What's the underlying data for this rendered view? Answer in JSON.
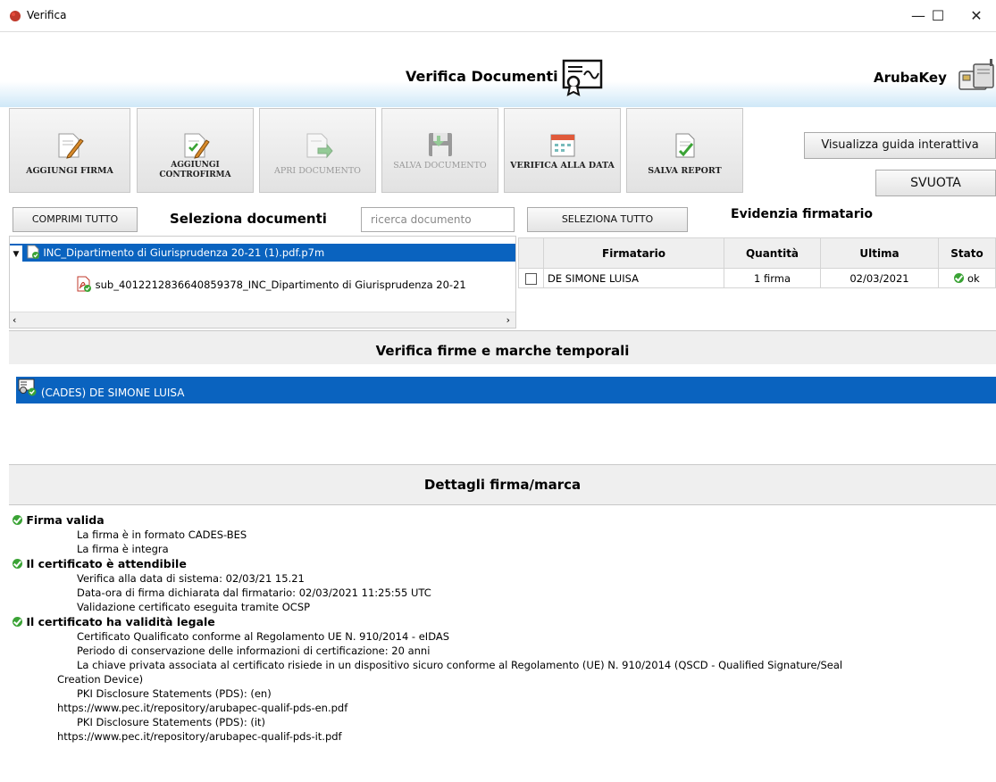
{
  "window": {
    "title": "Verifica",
    "minimize": "—",
    "maximize": "☐",
    "close": "✕"
  },
  "header": {
    "title": "Verifica Documenti",
    "brand": "ArubaKey"
  },
  "toolbar": {
    "add_signature": "AGGIUNGI FIRMA",
    "add_countersignature": "AGGIUNGI CONTROFIRMA",
    "open_document": "APRI DOCUMENTO",
    "save_document": "SALVA DOCUMENTO",
    "verify_at_date": "VERIFICA ALLA DATA",
    "save_report": "SALVA REPORT",
    "guide": "Visualizza guida interattiva",
    "empty": "SVUOTA"
  },
  "documents": {
    "collapse_all": "COMPRIMI TUTTO",
    "section_label": "Seleziona documenti",
    "search_placeholder": "ricerca documento",
    "tree": [
      "INC_Dipartimento di Giurisprudenza 20-21 (1).pdf.p7m",
      "sub_4012212836640859378_INC_Dipartimento di Giurisprudenza 20-21"
    ]
  },
  "signers": {
    "select_all": "SELEZIONA TUTTO",
    "section_label": "Evidenzia firmatario",
    "columns": [
      "Firmatario",
      "Quantità",
      "Ultima",
      "Stato"
    ],
    "rows": [
      {
        "name": "DE SIMONE LUISA",
        "qty": "1 firma",
        "last": "02/03/2021",
        "status": "ok"
      }
    ]
  },
  "verification": {
    "section_label": "Verifica firme e marche temporali",
    "items": [
      "(CADES) DE SIMONE LUISA"
    ]
  },
  "details": {
    "section_label": "Dettagli firma/marca",
    "lines": [
      "Firma valida",
      "La firma è in formato CADES-BES",
      "La firma è integra",
      "Il certificato è attendibile",
      "Verifica alla data di sistema: 02/03/21 15.21",
      "Data-ora di firma dichiarata dal firmatario: 02/03/2021 11:25:55 UTC",
      "Validazione certificato eseguita tramite OCSP",
      "Il certificato ha validità legale",
      "Certificato Qualificato conforme al Regolamento UE N. 910/2014 - eIDAS",
      "Periodo di conservazione delle informazioni di certificazione: 20 anni",
      "La chiave privata associata al certificato risiede in un dispositivo sicuro conforme al Regolamento (UE) N. 910/2014 (QSCD - Qualified Signature/Seal",
      "Creation Device)",
      "PKI Disclosure Statements (PDS): (en)",
      "https://www.pec.it/repository/arubapec-qualif-pds-en.pdf",
      "PKI Disclosure Statements (PDS): (it)",
      "https://www.pec.it/repository/arubapec-qualif-pds-it.pdf"
    ]
  },
  "colors": {
    "selection": "#0a63bf",
    "ok_green": "#3aa335"
  }
}
